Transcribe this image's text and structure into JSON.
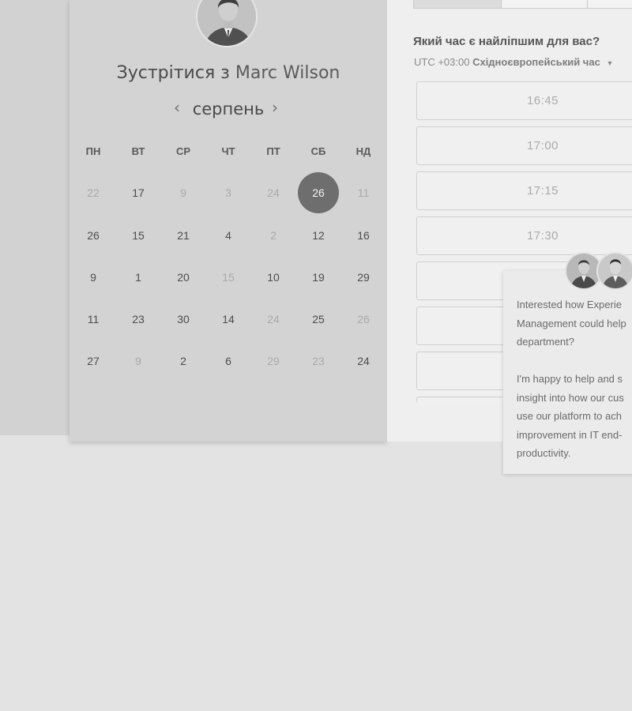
{
  "scheduler": {
    "title_prefix": "Зустрітися з",
    "host_name": "Marc Wilson",
    "month": "серпень",
    "weekdays": [
      "ПН",
      "ВТ",
      "СР",
      "ЧТ",
      "ПТ",
      "СБ",
      "НД"
    ],
    "weeks": [
      [
        {
          "d": "22",
          "faded": true
        },
        {
          "d": "17",
          "faded": false
        },
        {
          "d": "9",
          "faded": true
        },
        {
          "d": "3",
          "faded": true
        },
        {
          "d": "24",
          "faded": true
        },
        {
          "d": "26",
          "faded": false,
          "selected": true
        },
        {
          "d": "11",
          "faded": true
        }
      ],
      [
        {
          "d": "26",
          "faded": false
        },
        {
          "d": "15",
          "faded": false
        },
        {
          "d": "21",
          "faded": false
        },
        {
          "d": "4",
          "faded": false
        },
        {
          "d": "2",
          "faded": true
        },
        {
          "d": "12",
          "faded": false
        },
        {
          "d": "16",
          "faded": false
        }
      ],
      [
        {
          "d": "9",
          "faded": false
        },
        {
          "d": "1",
          "faded": false
        },
        {
          "d": "20",
          "faded": false
        },
        {
          "d": "15",
          "faded": true
        },
        {
          "d": "10",
          "faded": false
        },
        {
          "d": "19",
          "faded": false
        },
        {
          "d": "29",
          "faded": false
        }
      ],
      [
        {
          "d": "11",
          "faded": false
        },
        {
          "d": "23",
          "faded": false
        },
        {
          "d": "30",
          "faded": false
        },
        {
          "d": "14",
          "faded": false
        },
        {
          "d": "24",
          "faded": true
        },
        {
          "d": "25",
          "faded": false
        },
        {
          "d": "26",
          "faded": true
        }
      ],
      [
        {
          "d": "27",
          "faded": false
        },
        {
          "d": "9",
          "faded": true
        },
        {
          "d": "2",
          "faded": false
        },
        {
          "d": "6",
          "faded": false
        },
        {
          "d": "29",
          "faded": true
        },
        {
          "d": "23",
          "faded": true
        },
        {
          "d": "24",
          "faded": false
        }
      ]
    ]
  },
  "times": {
    "question": "Який час є найліпшим для вас?",
    "tz_prefix": "UTC +03:00",
    "tz_name": "Східноєвропейський час",
    "slots": [
      "16:45",
      "17:00",
      "17:15",
      "17:30",
      "",
      "",
      ""
    ]
  },
  "chat": {
    "message": "Interested how Experie\nManagement could help\ndepartment?\n\nI'm happy to help and s\ninsight into how our cus\nuse our platform to ach\nimprovement in IT end-\nproductivity."
  },
  "colors": {
    "selected_day": "#6e6e6e",
    "page_background": "#e3e3e3"
  }
}
